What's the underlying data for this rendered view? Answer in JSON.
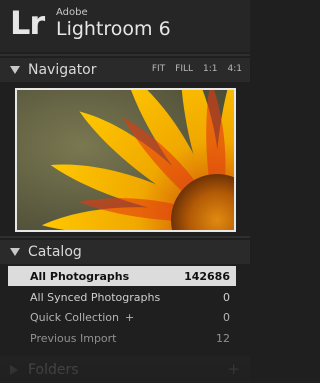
{
  "brand": {
    "logo": "Lr",
    "company": "Adobe",
    "product": "Lightroom 6"
  },
  "navigator": {
    "title": "Navigator",
    "zoom_options": [
      "FIT",
      "FILL",
      "1:1",
      "4:1"
    ],
    "preview_colors": {
      "petal_yellow": "#f5b400",
      "petal_red": "#d33b12",
      "center": "#b55a00",
      "background": "#5e5c40"
    }
  },
  "catalog": {
    "title": "Catalog",
    "items": [
      {
        "label": "All Photographs",
        "count": "142686",
        "selected": true
      },
      {
        "label": "All Synced Photographs",
        "count": "0"
      },
      {
        "label": "Quick Collection",
        "suffix": "+",
        "count": "0"
      },
      {
        "label": "Previous Import",
        "count": "12"
      }
    ]
  },
  "folders": {
    "title": "Folders",
    "add": "+"
  }
}
